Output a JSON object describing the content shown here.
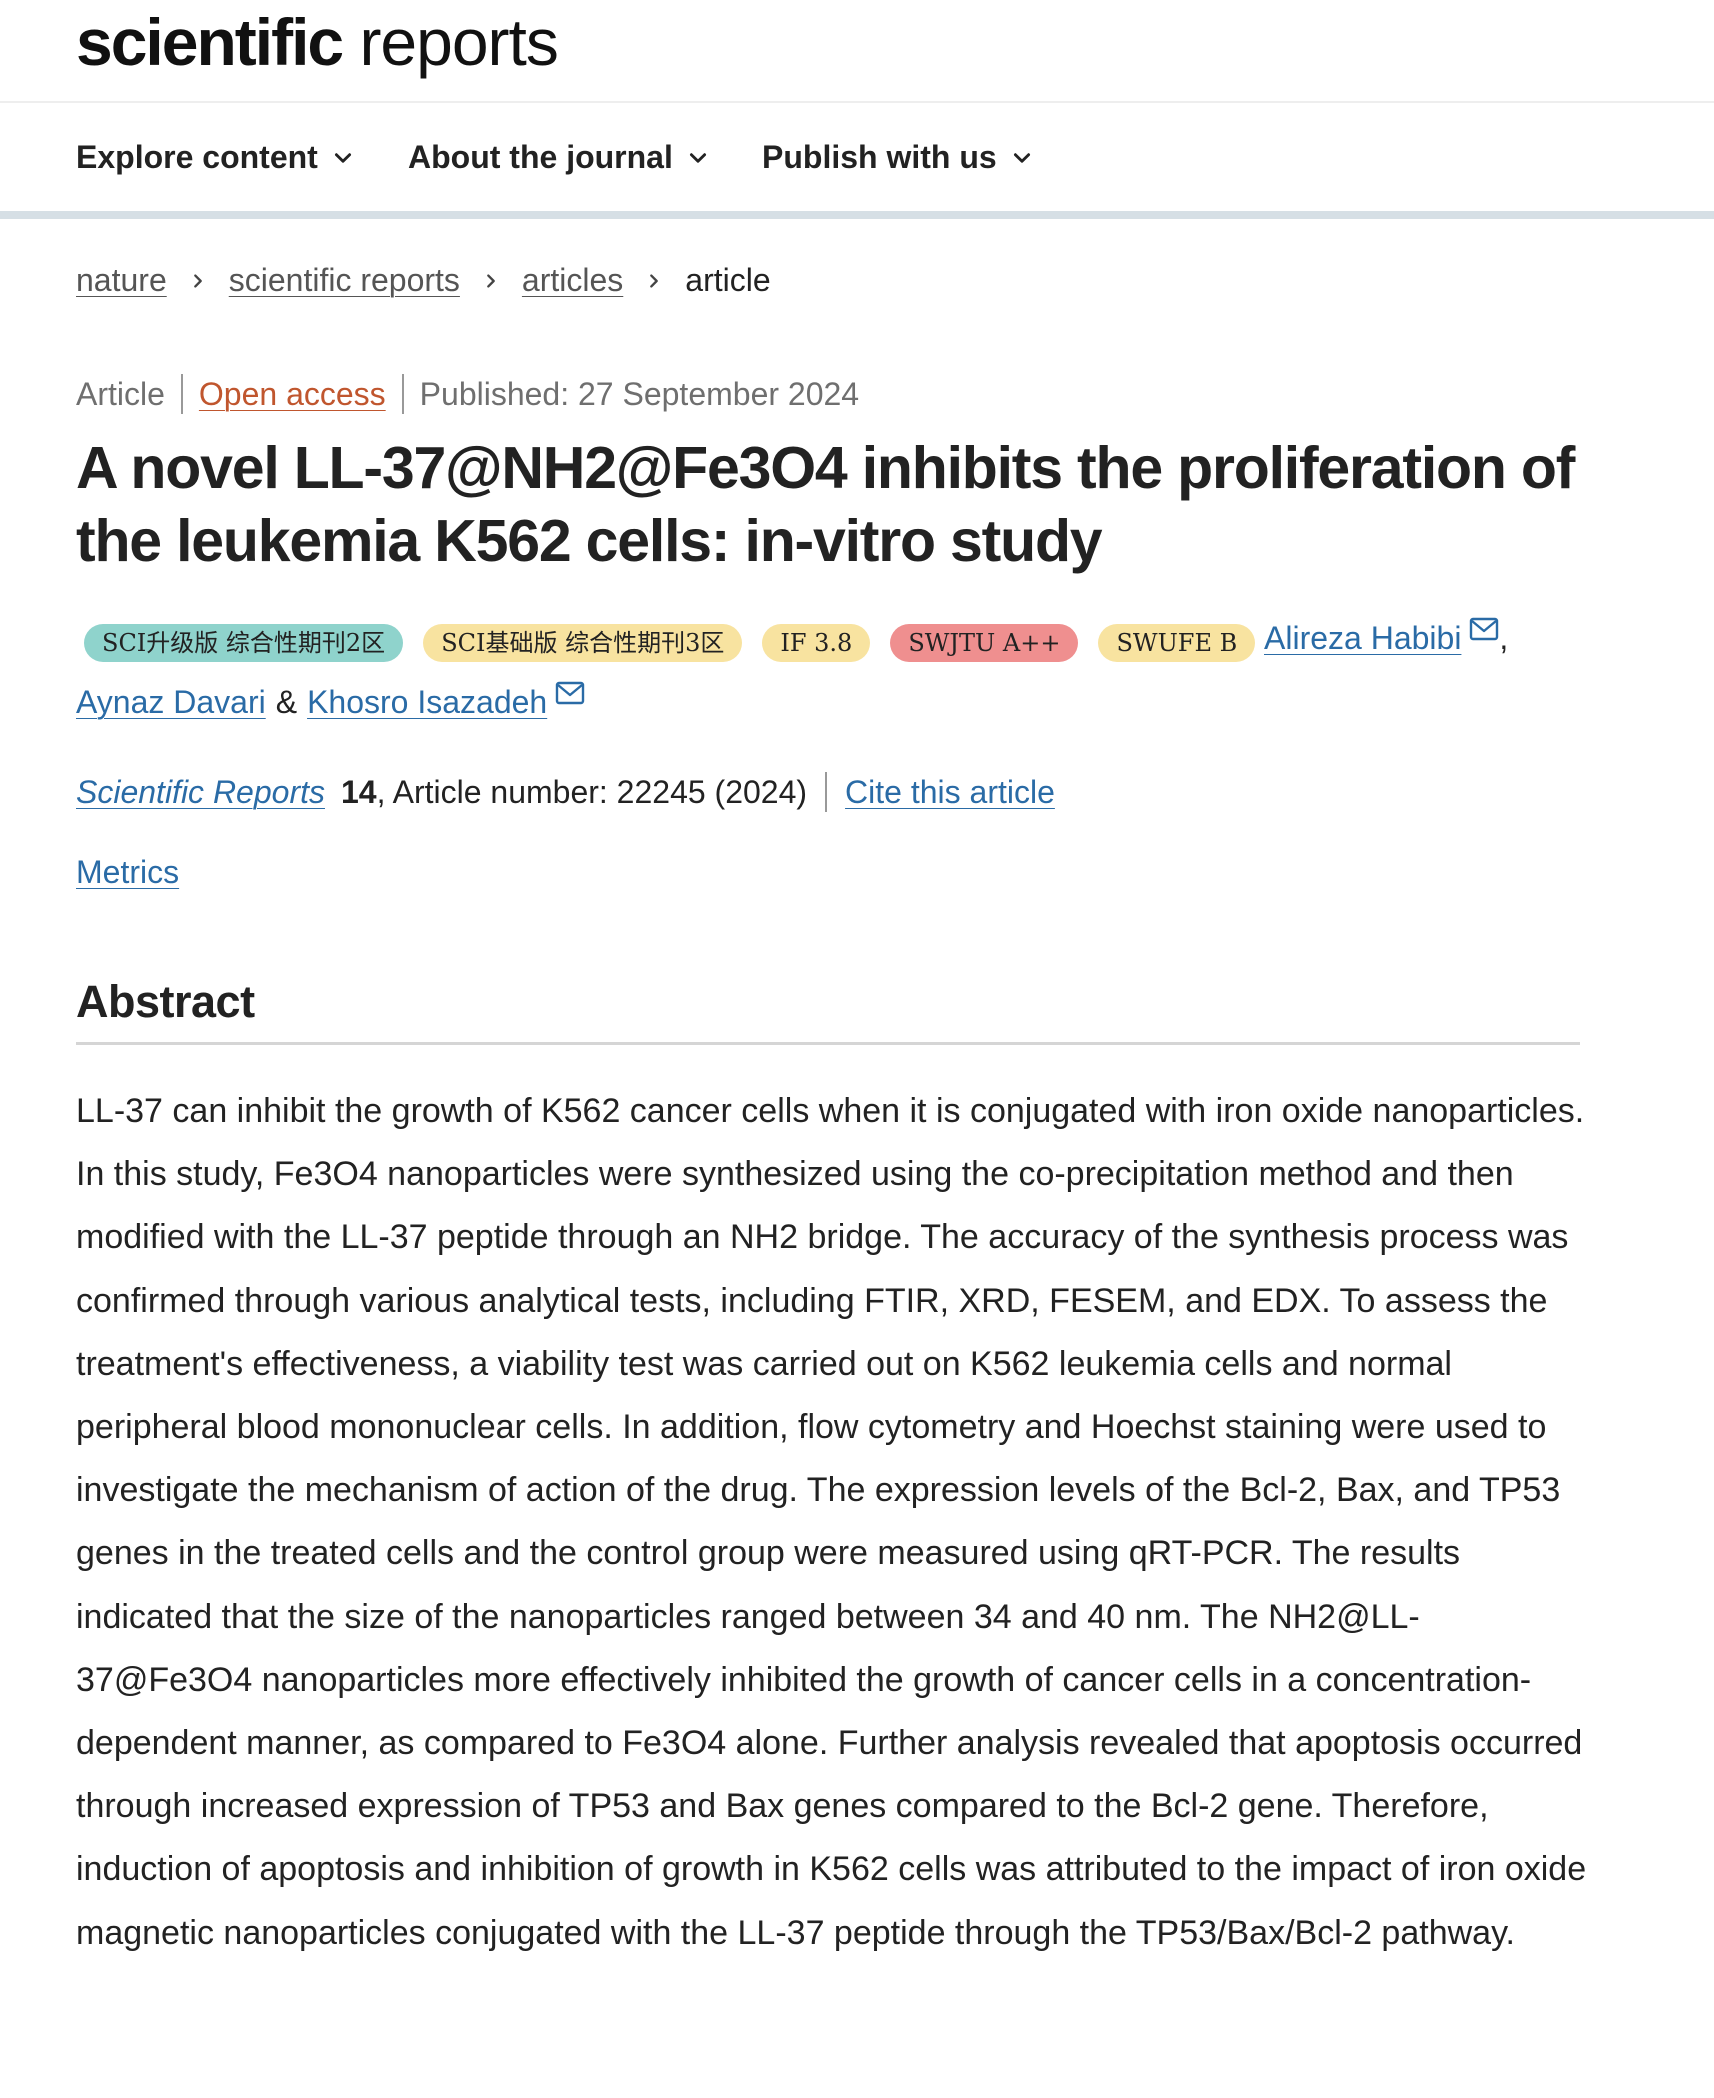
{
  "site": {
    "logo_bold": "scientific",
    "logo_light": "reports"
  },
  "nav": {
    "items": [
      {
        "label": "Explore content"
      },
      {
        "label": "About the journal"
      },
      {
        "label": "Publish with us"
      }
    ]
  },
  "breadcrumb": {
    "items": [
      {
        "label": "nature"
      },
      {
        "label": "scientific reports"
      },
      {
        "label": "articles"
      }
    ],
    "current": "article"
  },
  "article": {
    "type": "Article",
    "access": "Open access",
    "published": "Published: 27 September 2024",
    "title": "A novel LL-37@NH2@Fe3O4 inhibits the proliferation of the leukemia K562 cells: in-vitro study",
    "badges": [
      {
        "label": "SCI升级版 综合性期刊2区",
        "color": "#8fd3cc"
      },
      {
        "label": "SCI基础版 综合性期刊3区",
        "color": "#f8e3a0"
      },
      {
        "label": "IF 3.8",
        "color": "#f8e3a0"
      },
      {
        "label": "SWJTU A++",
        "color": "#ef8f8f"
      },
      {
        "label": "SWUFE B",
        "color": "#f8e3a0"
      }
    ],
    "authors": {
      "first": "Alireza Habibi",
      "comma": ",",
      "second": "Aynaz Davari",
      "amp": "&",
      "third": "Khosro Isazadeh"
    },
    "citation": {
      "journal": "Scientific Reports",
      "volume": "14",
      "rest": ", Article number: 22245 (2024)",
      "cite_link": "Cite this article"
    },
    "metrics_link": "Metrics"
  },
  "abstract": {
    "heading": "Abstract",
    "text": "LL-37 can inhibit the growth of K562 cancer cells when it is conjugated with iron oxide nanoparticles. In this study, Fe3O4 nanoparticles were synthesized using the co-precipitation method and then modified with the LL-37 peptide through an NH2 bridge. The accuracy of the synthesis process was confirmed through various analytical tests, including FTIR, XRD, FESEM, and EDX. To assess the treatment's effectiveness, a viability test was carried out on K562 leukemia cells and normal peripheral blood mononuclear cells. In addition, flow cytometry and Hoechst staining were used to investigate the mechanism of action of the drug. The expression levels of the Bcl-2, Bax, and TP53 genes in the treated cells and the control group were measured using qRT-PCR. The results indicated that the size of the nanoparticles ranged between 34 and 40 nm. The NH2@LL-37@Fe3O4 nanoparticles more effectively inhibited the growth of cancer cells in a concentration-dependent manner, as compared to Fe3O4 alone. Further analysis revealed that apoptosis occurred through increased expression of TP53 and Bax genes compared to the Bcl-2 gene. Therefore, induction of apoptosis and inhibition of growth in K562 cells was attributed to the impact of iron oxide magnetic nanoparticles conjugated with the LL-37 peptide through the TP53/Bax/Bcl-2 pathway."
  },
  "icons": {
    "nav_dropdown": "chevron-down-icon",
    "breadcrumb_separator": "chevron-right-icon",
    "author_contact": "mail-icon"
  },
  "colors": {
    "link": "#2a6ba6",
    "open_access": "#c0562e",
    "nav_border": "#d6dfe5"
  }
}
